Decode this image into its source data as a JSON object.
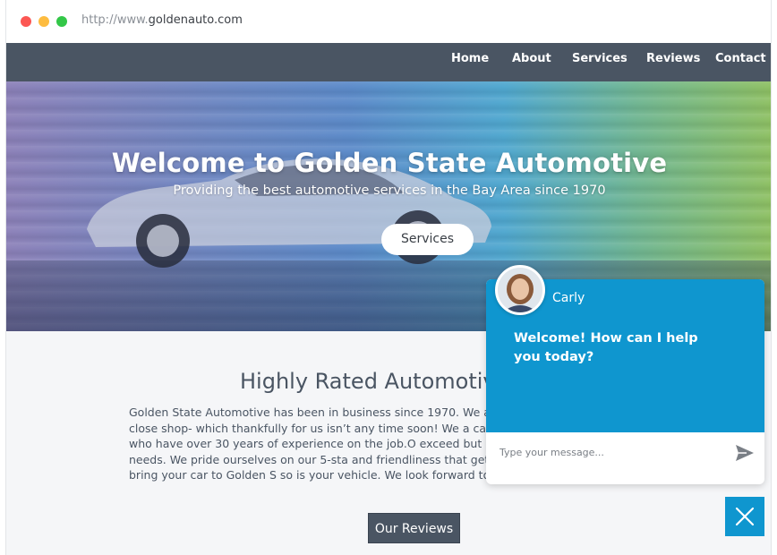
{
  "browser": {
    "url_prefix": "http://www.",
    "url_host": "goldenauto.com"
  },
  "nav": {
    "items": [
      {
        "label": "Home"
      },
      {
        "label": "About"
      },
      {
        "label": "Services"
      },
      {
        "label": "Reviews"
      },
      {
        "label": "Contact"
      }
    ]
  },
  "hero": {
    "title": "Welcome to Golden State Automotive",
    "subtitle": "Providing the best automotive services in the Bay Area since 1970",
    "button_label": "Services"
  },
  "about": {
    "heading": "Highly Rated Automotive",
    "body": "Golden State Automotive has been in business since 1970. We are famil way until we close shop- which thankfully for us isn’t any time soon! We a car obsessed people who have over 30 years of experience on the job.O exceed but meet all of your auto needs. We pride ourselves on our 5-sta and friendliness that gets us there. When you bring your car to Golden S so is your vehicle. We look forward to serving you soon!",
    "reviews_button": "Our Reviews"
  },
  "chat": {
    "agent_name": "Carly",
    "message": "Welcome! How can I help you today?",
    "input_placeholder": "Type your message...",
    "accent_color": "#0f96cf"
  },
  "icons": {
    "send": "send-icon",
    "close": "close-icon"
  },
  "colors": {
    "nav_bg": "#4a5563",
    "chat_blue": "#0f96cf"
  }
}
